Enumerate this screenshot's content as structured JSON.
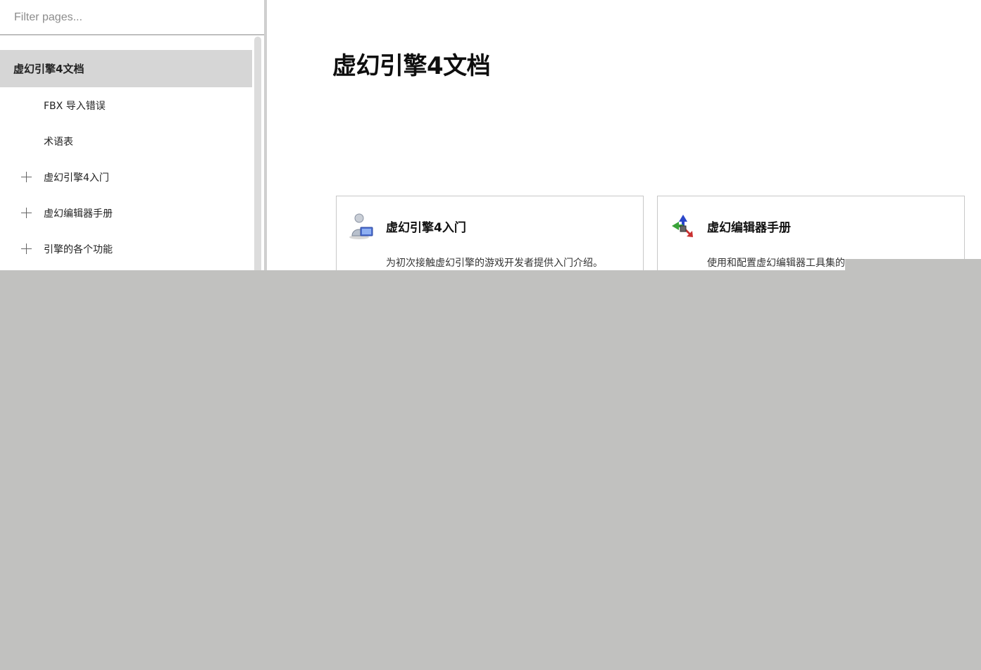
{
  "sidebar": {
    "filter_placeholder": "Filter pages...",
    "items": [
      {
        "label": "虚幻引擎4文档",
        "active": true,
        "expandable": false
      },
      {
        "label": "FBX 导入错误",
        "active": false,
        "expandable": false
      },
      {
        "label": "术语表",
        "active": false,
        "expandable": false
      },
      {
        "label": "虚幻引擎4入门",
        "active": false,
        "expandable": true
      },
      {
        "label": "虚幻编辑器手册",
        "active": false,
        "expandable": true
      },
      {
        "label": "引擎的各个功能",
        "active": false,
        "expandable": true
      }
    ]
  },
  "main": {
    "title": "虚幻引擎4文档",
    "cards": [
      {
        "title": "虚幻引擎4入门",
        "description": "为初次接触虚幻引擎的游戏开发者提供入门介绍。",
        "icon": "user-computer-icon"
      },
      {
        "title": "虚幻编辑器手册",
        "description": "使用和配置虚幻编辑器工具集的",
        "icon": "transform-gizmo-icon"
      }
    ]
  },
  "colors": {
    "active_item_bg": "#d6d6d6",
    "overlay_gray": "#c1c1bf"
  }
}
